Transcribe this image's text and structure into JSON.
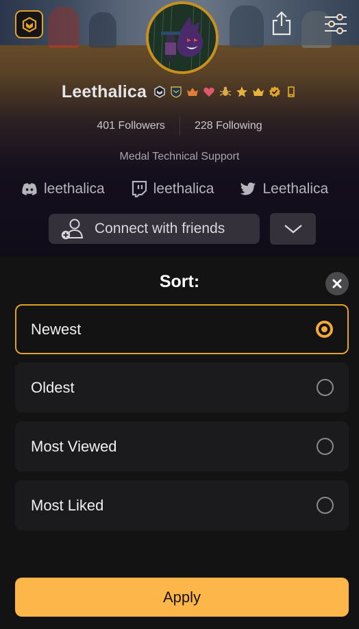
{
  "profile": {
    "username": "Leethalica",
    "badges": [
      "medal-logo-badge",
      "shield-badge",
      "crown-badge",
      "heart-badge",
      "bug-badge",
      "star-badge",
      "crown-badge-2",
      "verified-badge",
      "phone-badge"
    ],
    "followers_label": "401 Followers",
    "following_label": "228 Following",
    "bio": "Medal Technical Support",
    "socials": [
      {
        "icon": "discord-icon",
        "handle": "leethalica"
      },
      {
        "icon": "twitch-icon",
        "handle": "leethalica"
      },
      {
        "icon": "twitter-icon",
        "handle": "Leethalica"
      }
    ],
    "connect_label": "Connect with friends"
  },
  "sort_sheet": {
    "title": "Sort:",
    "options": [
      {
        "label": "Newest",
        "selected": true
      },
      {
        "label": "Oldest",
        "selected": false
      },
      {
        "label": "Most Viewed",
        "selected": false
      },
      {
        "label": "Most Liked",
        "selected": false
      }
    ],
    "apply_label": "Apply"
  },
  "colors": {
    "accent": "#fdb64a",
    "selected_border": "#e3a22a",
    "sheet_background": "#131314",
    "option_background": "#1b1b1d"
  }
}
